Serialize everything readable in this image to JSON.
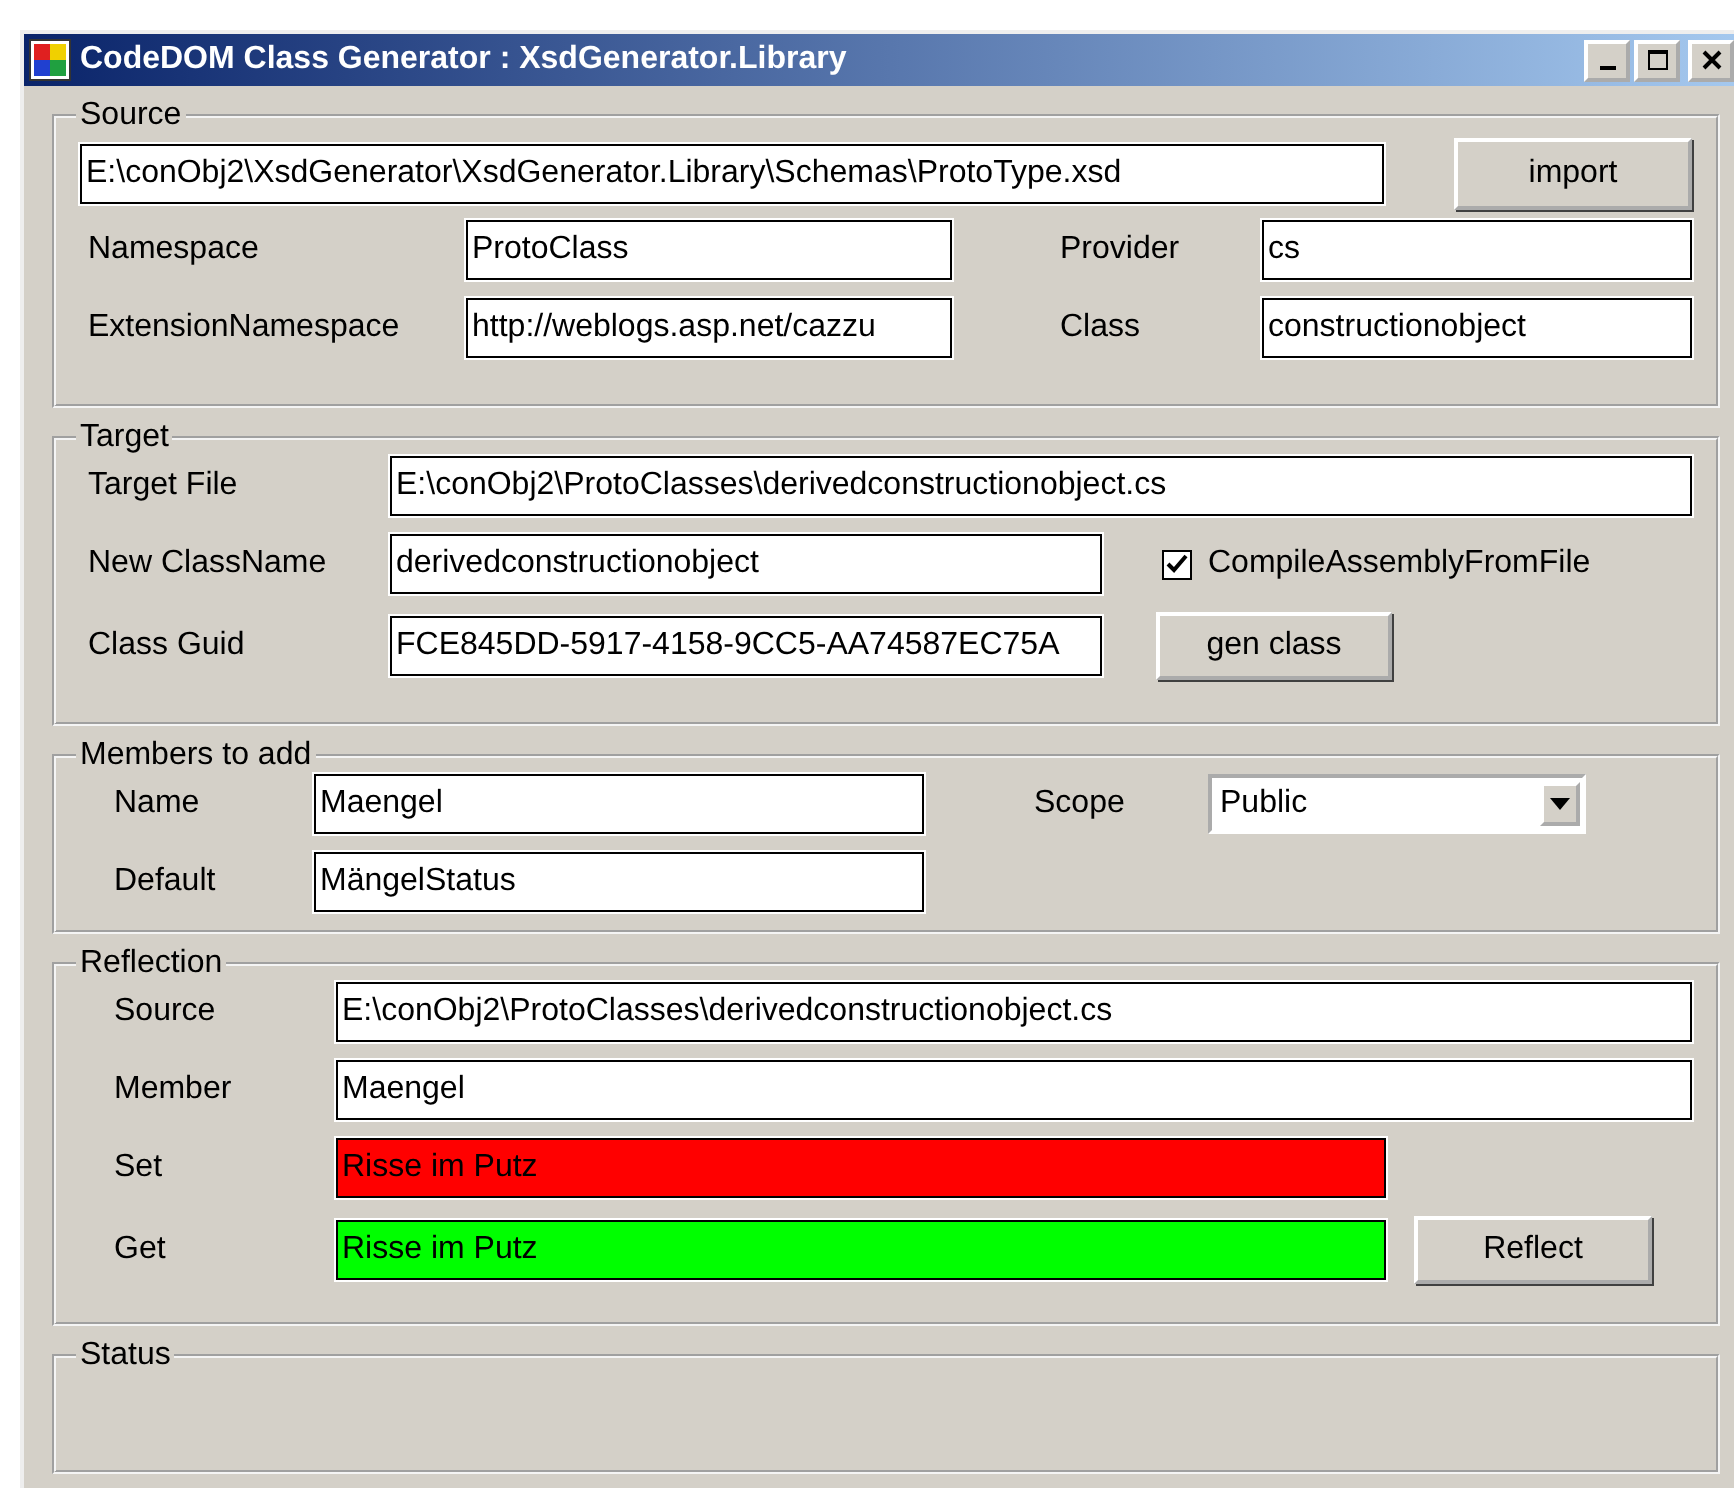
{
  "window": {
    "title": "CodeDOM Class Generator : XsdGenerator.Library"
  },
  "source": {
    "title": "Source",
    "path": "E:\\conObj2\\XsdGenerator\\XsdGenerator.Library\\Schemas\\ProtoType.xsd",
    "import_button": "import",
    "fields": [
      {
        "label": "Namespace",
        "value": "ProtoClass"
      },
      {
        "label": "Provider",
        "value": "cs"
      },
      {
        "label": "ExtensionNamespace",
        "value": "http://weblogs.asp.net/cazzu"
      },
      {
        "label": "Class",
        "value": "constructionobject"
      }
    ]
  },
  "target": {
    "title": "Target",
    "target_file": {
      "label": "Target File",
      "value": "E:\\conObj2\\ProtoClasses\\derivedconstructionobject.cs"
    },
    "class_name": {
      "label": "New ClassName",
      "value": "derivedconstructionobject"
    },
    "compile": {
      "label": "CompileAssemblyFromFile",
      "checked": true
    },
    "class_guid": {
      "label": "Class Guid",
      "value": "FCE845DD-5917-4158-9CC5-AA74587EC75A"
    },
    "gen_button": "gen class"
  },
  "members": {
    "title": "Members to add",
    "name": {
      "label": "Name",
      "value": "Maengel"
    },
    "scope": {
      "label": "Scope",
      "value": "Public"
    },
    "default": {
      "label": "Default",
      "value": "MängelStatus"
    }
  },
  "reflection": {
    "title": "Reflection",
    "rows": [
      {
        "label": "Source",
        "value": "E:\\conObj2\\ProtoClasses\\derivedconstructionobject.cs"
      },
      {
        "label": "Member",
        "value": "Maengel"
      },
      {
        "label": "Set",
        "value": "Risse im Putz",
        "color": "#ff0000"
      },
      {
        "label": "Get",
        "value": "Risse im Putz",
        "color": "#00ff00"
      }
    ],
    "reflect_button": "Reflect"
  },
  "status": {
    "title": "Status"
  }
}
